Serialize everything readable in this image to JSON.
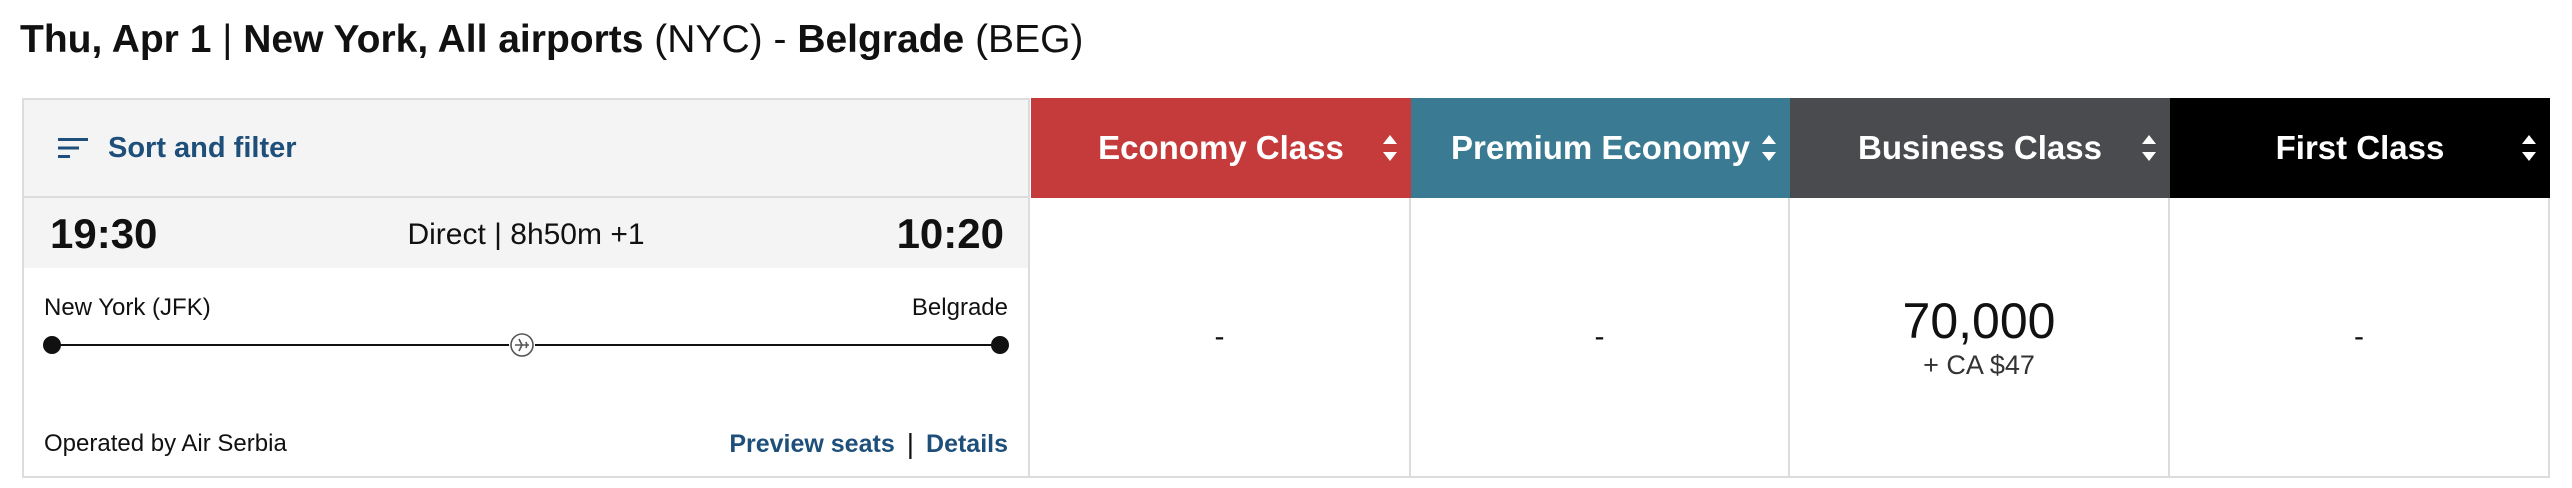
{
  "heading": {
    "date": "Thu, Apr 1",
    "separator": "|",
    "origin_city": "New York, All airports",
    "origin_code": "(NYC)",
    "dash": "-",
    "destination_city": "Belgrade",
    "destination_code": "(BEG)"
  },
  "filter": {
    "label": "Sort and filter",
    "icon": "filter-lines-icon"
  },
  "classes": [
    {
      "label": "Economy Class",
      "color": "#c53a3a"
    },
    {
      "label": "Premium Economy",
      "color": "#3a7a93"
    },
    {
      "label": "Business Class",
      "color": "#494b4f"
    },
    {
      "label": "First Class",
      "color": "#000000"
    }
  ],
  "flight": {
    "departure_time": "19:30",
    "summary": "Direct | 8h50m +1",
    "arrival_time": "10:20",
    "origin": "New York (JFK)",
    "destination": "Belgrade",
    "operated_by": "Operated by Air Serbia",
    "preview_seats": "Preview seats",
    "link_separator": "|",
    "details": "Details"
  },
  "fares": {
    "economy": "-",
    "premium": "-",
    "business_miles": "70,000",
    "business_tax": "+ CA $47",
    "first": "-"
  }
}
